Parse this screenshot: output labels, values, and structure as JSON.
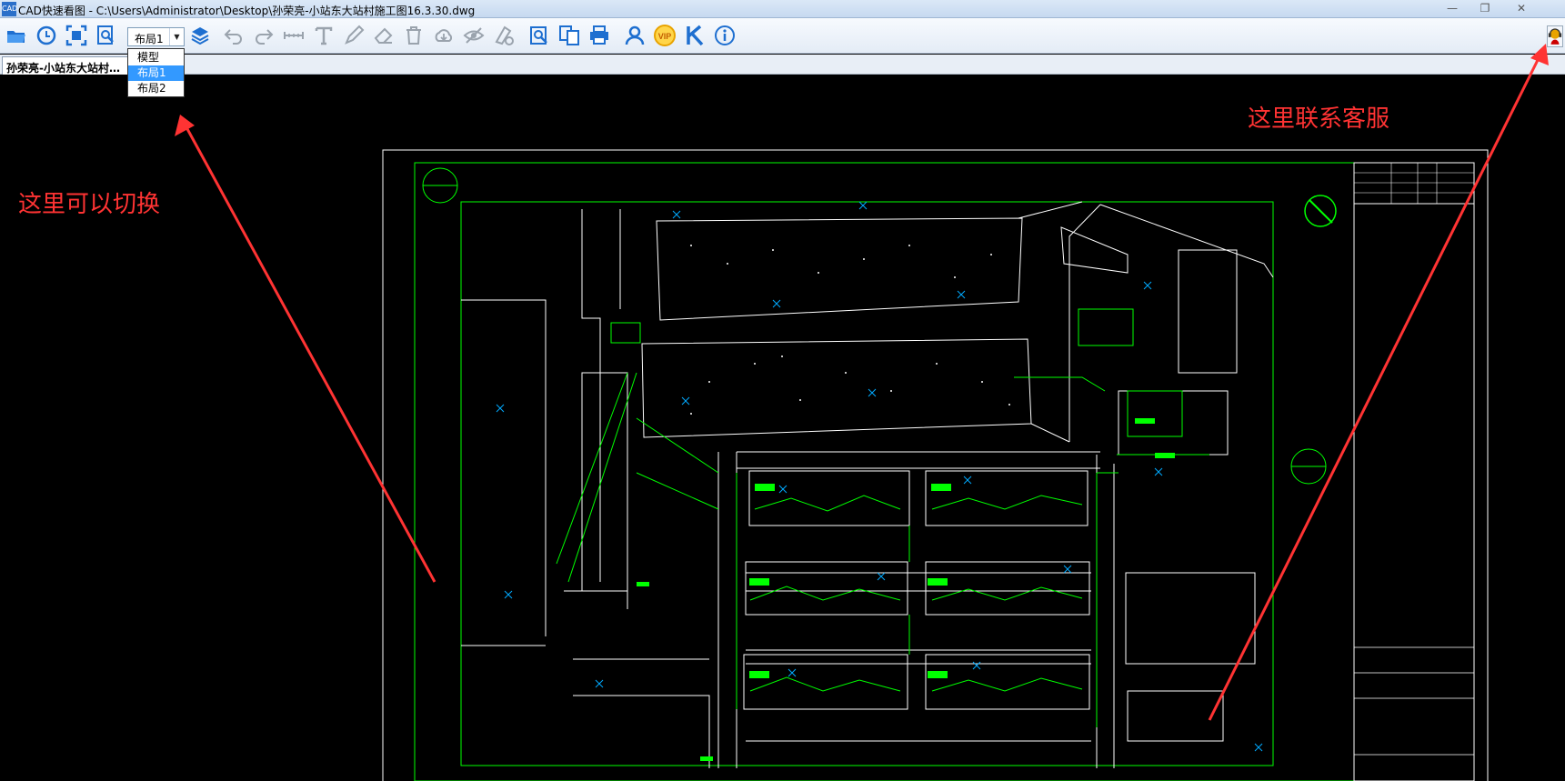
{
  "window": {
    "title": "CAD快速看图 - C:\\Users\\Administrator\\Desktop\\孙荣亮-小站东大站村施工图16.3.30.dwg",
    "icon": "cad-app-icon",
    "minimize": "—",
    "maximize": "❐",
    "close": "✕"
  },
  "toolbar": {
    "buttons": [
      {
        "name": "open-icon",
        "color": "#1e6fd0"
      },
      {
        "name": "history-icon",
        "color": "#1e6fd0"
      },
      {
        "name": "fit-extents-icon",
        "color": "#1e6fd0"
      },
      {
        "name": "zoom-window-icon",
        "color": "#1e6fd0"
      },
      {
        "name": "layers-icon",
        "color": "#1e6fd0"
      },
      {
        "name": "undo-icon",
        "color": "#9aa3ad"
      },
      {
        "name": "redo-icon",
        "color": "#9aa3ad"
      },
      {
        "name": "measure-icon",
        "color": "#9aa3ad"
      },
      {
        "name": "text-icon",
        "color": "#9aa3ad"
      },
      {
        "name": "pen-icon",
        "color": "#9aa3ad"
      },
      {
        "name": "eraser-icon",
        "color": "#9aa3ad"
      },
      {
        "name": "delete-icon",
        "color": "#9aa3ad"
      },
      {
        "name": "cloud-icon",
        "color": "#9aa3ad"
      },
      {
        "name": "hide-icon",
        "color": "#9aa3ad"
      },
      {
        "name": "settings-icon",
        "color": "#9aa3ad"
      },
      {
        "name": "find-icon",
        "color": "#1e6fd0"
      },
      {
        "name": "convert-icon",
        "color": "#1e6fd0"
      },
      {
        "name": "print-icon",
        "color": "#1e6fd0"
      },
      {
        "name": "user-icon",
        "color": "#1e6fd0"
      },
      {
        "name": "vip-icon",
        "color": "#e8a300"
      },
      {
        "name": "k-icon",
        "color": "#1e6fd0"
      },
      {
        "name": "info-icon",
        "color": "#1e6fd0"
      }
    ],
    "layout_select": {
      "value": "布局1",
      "arrow": "▼"
    },
    "service_icon": "customer-service-icon"
  },
  "layout_dropdown": {
    "options": [
      "模型",
      "布局1",
      "布局2"
    ],
    "selected": "布局1"
  },
  "tabs": {
    "active_label": "孙荣亮-小站东大站村…"
  },
  "annotations": {
    "switch_hint": "这里可以切换",
    "service_hint": "这里联系客服",
    "color": "#ff3333"
  },
  "drawing": {
    "frame_color": "#ffffff",
    "border_color": "#00ff00",
    "line_color": "#ffffff",
    "label_color": "#00ff00"
  }
}
